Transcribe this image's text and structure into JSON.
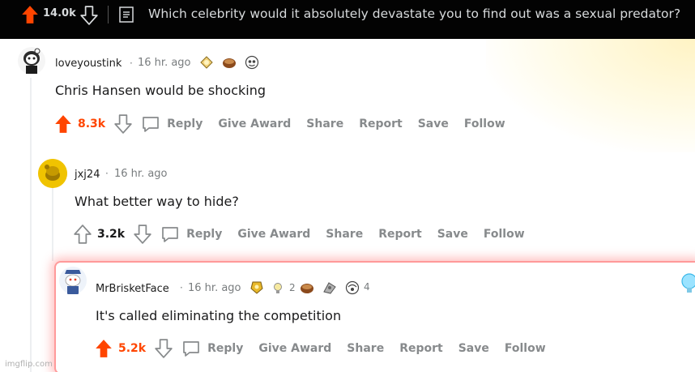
{
  "post": {
    "score": "14.0k",
    "title": "Which celebrity would it absolutely devastate you to find out was a sexual predator?"
  },
  "comments": [
    {
      "username": "loveyoustink",
      "time": "16 hr. ago",
      "body": "Chris Hansen would be shocking",
      "score": "8.3k",
      "upvoted": true
    },
    {
      "username": "jxj24",
      "time": "16 hr. ago",
      "body": "What better way to hide?",
      "score": "3.2k",
      "upvoted": false
    },
    {
      "username": "MrBrisketFace",
      "time": "16 hr. ago",
      "body": "It's called eliminating the competition",
      "score": "5.2k",
      "upvoted": true,
      "award_count_1": "2",
      "award_count_2": "4"
    }
  ],
  "actions": {
    "reply": "Reply",
    "give_award": "Give Award",
    "share": "Share",
    "report": "Report",
    "save": "Save",
    "follow": "Follow"
  },
  "separator": "·",
  "watermark": "imgflip.com",
  "colors": {
    "upvote": "#ff4500",
    "topbar": "#030303",
    "meta": "#787c7e",
    "action": "#878a8c"
  }
}
